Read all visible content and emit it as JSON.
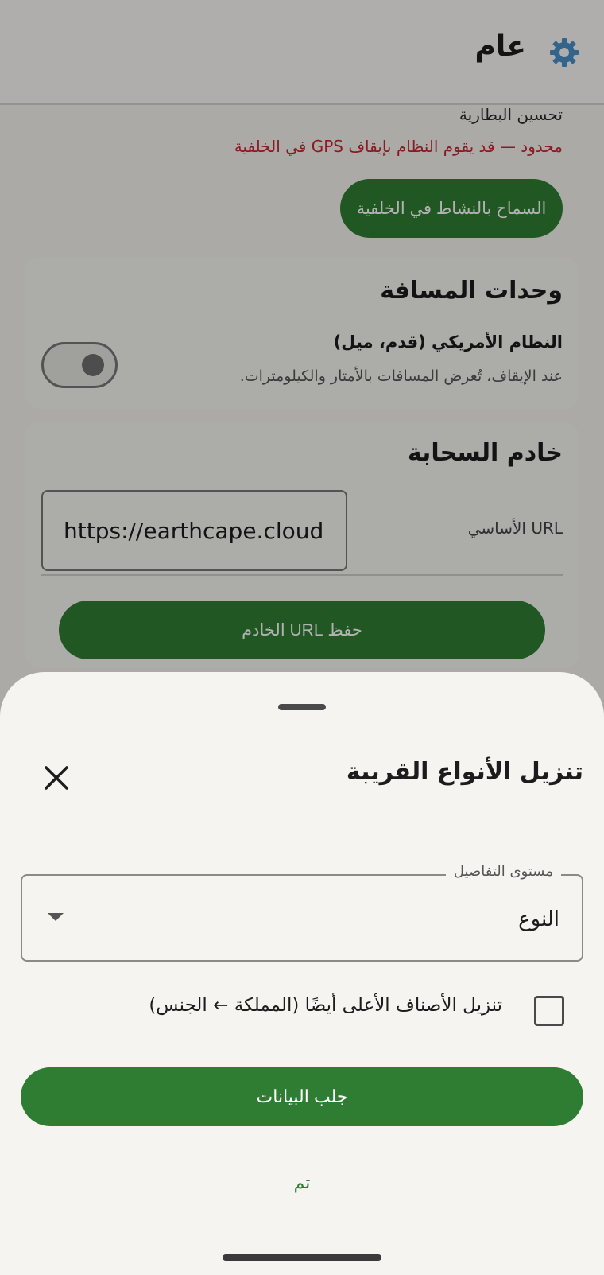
{
  "header": {
    "title": "عام",
    "icon": "gear-icon"
  },
  "battery": {
    "label": "تحسين البطارية",
    "status": "محدود — قد يقوم النظام بإيقاف GPS في الخلفية",
    "status_color": "#c6262e",
    "allow_button": "السماح بالنشاط في الخلفية"
  },
  "units": {
    "title": "وحدات المسافة",
    "option_label": "النظام الأمريكي (قدم، ميل)",
    "option_desc": "عند الإيقاف، تُعرض المسافات بالأمتار والكيلومترات.",
    "toggle_on": false
  },
  "cloud": {
    "title": "خادم السحابة",
    "url_label": "URL الأساسي",
    "url_value": "https://earthcape.cloud",
    "save_button": "حفظ URL الخادم"
  },
  "sheet": {
    "title": "تنزيل الأنواع القريبة",
    "detail_level_label": "مستوى التفاصيل",
    "detail_level_value": "النوع",
    "checkbox_label": "تنزيل الأصناف الأعلى أيضًا (المملكة ← الجنس)",
    "checkbox_checked": false,
    "fetch_button": "جلب البيانات",
    "done_button": "تم"
  },
  "colors": {
    "accent": "#2e7d32",
    "sheet_background": "#f5f4f0"
  }
}
